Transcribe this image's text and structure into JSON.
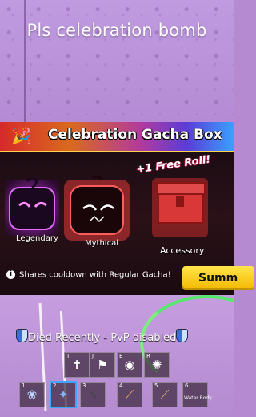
{
  "caption": "Pls celebration bomb",
  "banner": {
    "title": "Celebration Gacha Box",
    "free_roll": "+1 Free Roll!",
    "items": [
      {
        "label": "Legendary",
        "color": "#c23bd9"
      },
      {
        "label": "Mythical",
        "color": "#e03a3a"
      },
      {
        "label": "Accessory",
        "color": "#d83838"
      }
    ],
    "info_text": "Shares cooldown with Regular Gacha!",
    "summon_label": "Summ"
  },
  "status": {
    "pvp_text": "Died Recently - PvP disabled"
  },
  "hotbar": {
    "skills": [
      {
        "key": "T",
        "icon": "figure-icon"
      },
      {
        "key": "J",
        "icon": "flag-icon"
      },
      {
        "key": "E",
        "icon": "eye-icon"
      },
      {
        "key": "R",
        "icon": "swirl-icon"
      }
    ],
    "slots": [
      {
        "num": "1",
        "icon": "plant-icon",
        "name": ""
      },
      {
        "num": "2",
        "icon": "fruit-icon",
        "name": ""
      },
      {
        "num": "3",
        "icon": "whip-icon",
        "name": ""
      },
      {
        "num": "4",
        "icon": "staff-icon",
        "name": ""
      },
      {
        "num": "5",
        "icon": "scythe-icon",
        "name": ""
      },
      {
        "num": "6",
        "icon": "text-icon",
        "name": "Water Body"
      }
    ]
  }
}
